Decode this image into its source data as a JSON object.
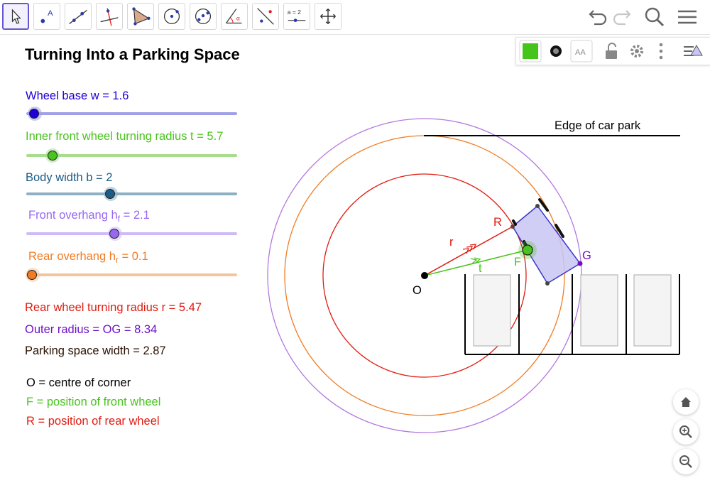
{
  "title": "Turning Into a Parking Space",
  "toolbar": {
    "tools": [
      {
        "name": "move-tool",
        "selected": true
      },
      {
        "name": "point-tool",
        "label": "A"
      },
      {
        "name": "line-tool"
      },
      {
        "name": "perpendicular-line-tool"
      },
      {
        "name": "polygon-tool"
      },
      {
        "name": "circle-center-point-tool"
      },
      {
        "name": "circle-three-points-tool"
      },
      {
        "name": "angle-tool",
        "label": "α"
      },
      {
        "name": "reflect-tool"
      },
      {
        "name": "slider-tool",
        "label": "a = 2"
      },
      {
        "name": "move-graphics-view-tool"
      }
    ],
    "right_icons": [
      "undo-icon",
      "redo-icon",
      "search-icon",
      "menu-icon"
    ]
  },
  "style_bar": {
    "color": "#44c51a",
    "icons": [
      "color-icon",
      "point-style-icon",
      "label-style-icon",
      "lock-icon",
      "settings-icon",
      "more-icon",
      "toggle-style-bar-icon"
    ],
    "label_style_text": "AA"
  },
  "sliders": [
    {
      "label": "Wheel base w = 1.6",
      "color": "#1f00d7",
      "track": "#9fa0e6",
      "value_fraction": 0.04
    },
    {
      "label": "Inner front wheel turning radius t = 5.7",
      "color": "#48c41c",
      "track": "#a6dd8e",
      "value_fraction": 0.125
    },
    {
      "label": "Body width b = 2",
      "color": "#1c5c86",
      "track": "#8db0c5",
      "value_fraction": 0.4
    },
    {
      "label_main": "Front overhang h",
      "label_sub": "f",
      "label_rest": " = 2.1",
      "color": "#9668f0",
      "track": "#cdbaf6",
      "value_fraction": 0.42
    },
    {
      "label_main": "Rear overhang h",
      "label_sub": "r",
      "label_rest": " = 0.1",
      "color": "#f07c24",
      "track": "#f4c59c",
      "value_fraction": 0.03
    }
  ],
  "info": [
    {
      "text": "Rear wheel turning radius r = 5.47",
      "color": "#e01c12"
    },
    {
      "text": "Outer radius = OG = 8.34",
      "color": "#7010c8"
    },
    {
      "text": "Parking space width = 2.87",
      "color": "#2a1000"
    }
  ],
  "legend": [
    {
      "text": "O = centre of corner",
      "color": "#000000"
    },
    {
      "text": "F = position of front wheel",
      "color": "#48c41c"
    },
    {
      "text": "R = position of rear wheel",
      "color": "#e01c12"
    }
  ],
  "diagram": {
    "edge_label": "Edge of car park",
    "point_labels": {
      "O": "O",
      "R": "R",
      "F": "F",
      "G": "G",
      "r": "r",
      "t": "t"
    },
    "colors": {
      "outer_circle": "#b478e0",
      "mid_circle": "#f07c24",
      "rear_circle": "#e01c12",
      "car_fill": "#c9c6f5",
      "car_stroke": "#3a36c8",
      "front_wheel": "#48c41c",
      "rear_wheel": "#e01c12",
      "label_G": "#7010c8"
    }
  },
  "nav": [
    "home-icon",
    "zoom-in-icon",
    "zoom-out-icon"
  ]
}
